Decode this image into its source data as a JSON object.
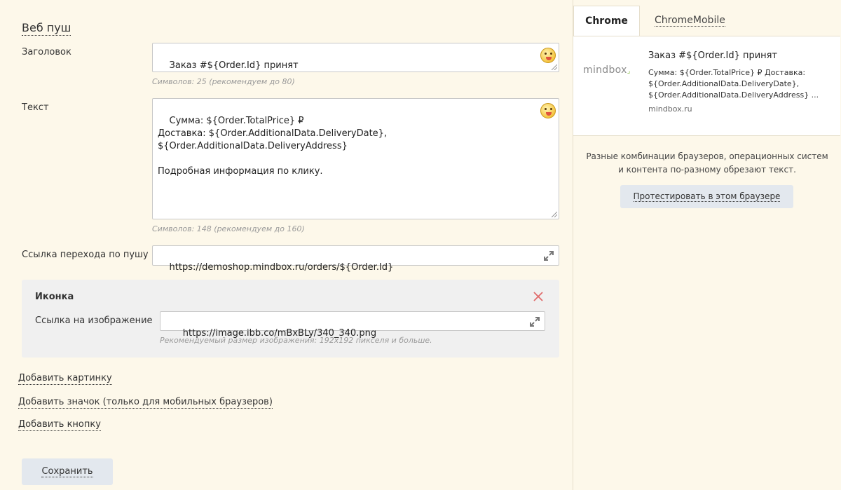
{
  "editor": {
    "section_title": "Веб пуш",
    "title_label": "Заголовок",
    "title_value": "Заказ #${Order.Id} принят",
    "title_hint": "Символов: 25 (рекомендуем до 80)",
    "text_label": "Текст",
    "text_value": "Сумма: ${Order.TotalPrice} ₽\nДоставка: ${Order.AdditionalData.DeliveryDate},\n${Order.AdditionalData.DeliveryAddress}\n\nПодробная информация по клику.",
    "text_hint": "Символов: 148 (рекомендуем до 160)",
    "link_label": "Ссылка перехода по пушу",
    "link_value": "https://demoshop.mindbox.ru/orders/${Order.Id}",
    "icon_block": {
      "title": "Иконка",
      "image_label": "Ссылка на изображение",
      "image_value": "https://image.ibb.co/mBxBLy/340_340.png",
      "image_hint": "Рекомендуемый размер изображения: 192x192 пикселя и больше."
    },
    "add_picture": "Добавить картинку",
    "add_badge": "Добавить значок (только для мобильных браузеров)",
    "add_button": "Добавить кнопку",
    "save": "Сохранить"
  },
  "preview": {
    "tabs": [
      "Chrome",
      "ChromeMobile"
    ],
    "active_tab": "Chrome",
    "logo_text": "mindbox",
    "title": "Заказ #${Order.Id} принят",
    "body": "Сумма: ${Order.TotalPrice} ₽ Доставка:\n${Order.AdditionalData.DeliveryDate},\n${Order.AdditionalData.DeliveryAddress} ...",
    "domain": "mindbox.ru",
    "note": "Разные комбинации браузеров, операционных систем и контента по-разному обрезают текст.",
    "test_button": "Протестировать в этом браузере"
  },
  "icons": [
    "emoji-icon",
    "expand-icon",
    "close-icon",
    "resize-grip-icon"
  ],
  "colors": {
    "background": "#fdf8ea",
    "button": "#e3e8ee",
    "close": "#e06a6a",
    "logo_accent": "#8bc34a"
  }
}
